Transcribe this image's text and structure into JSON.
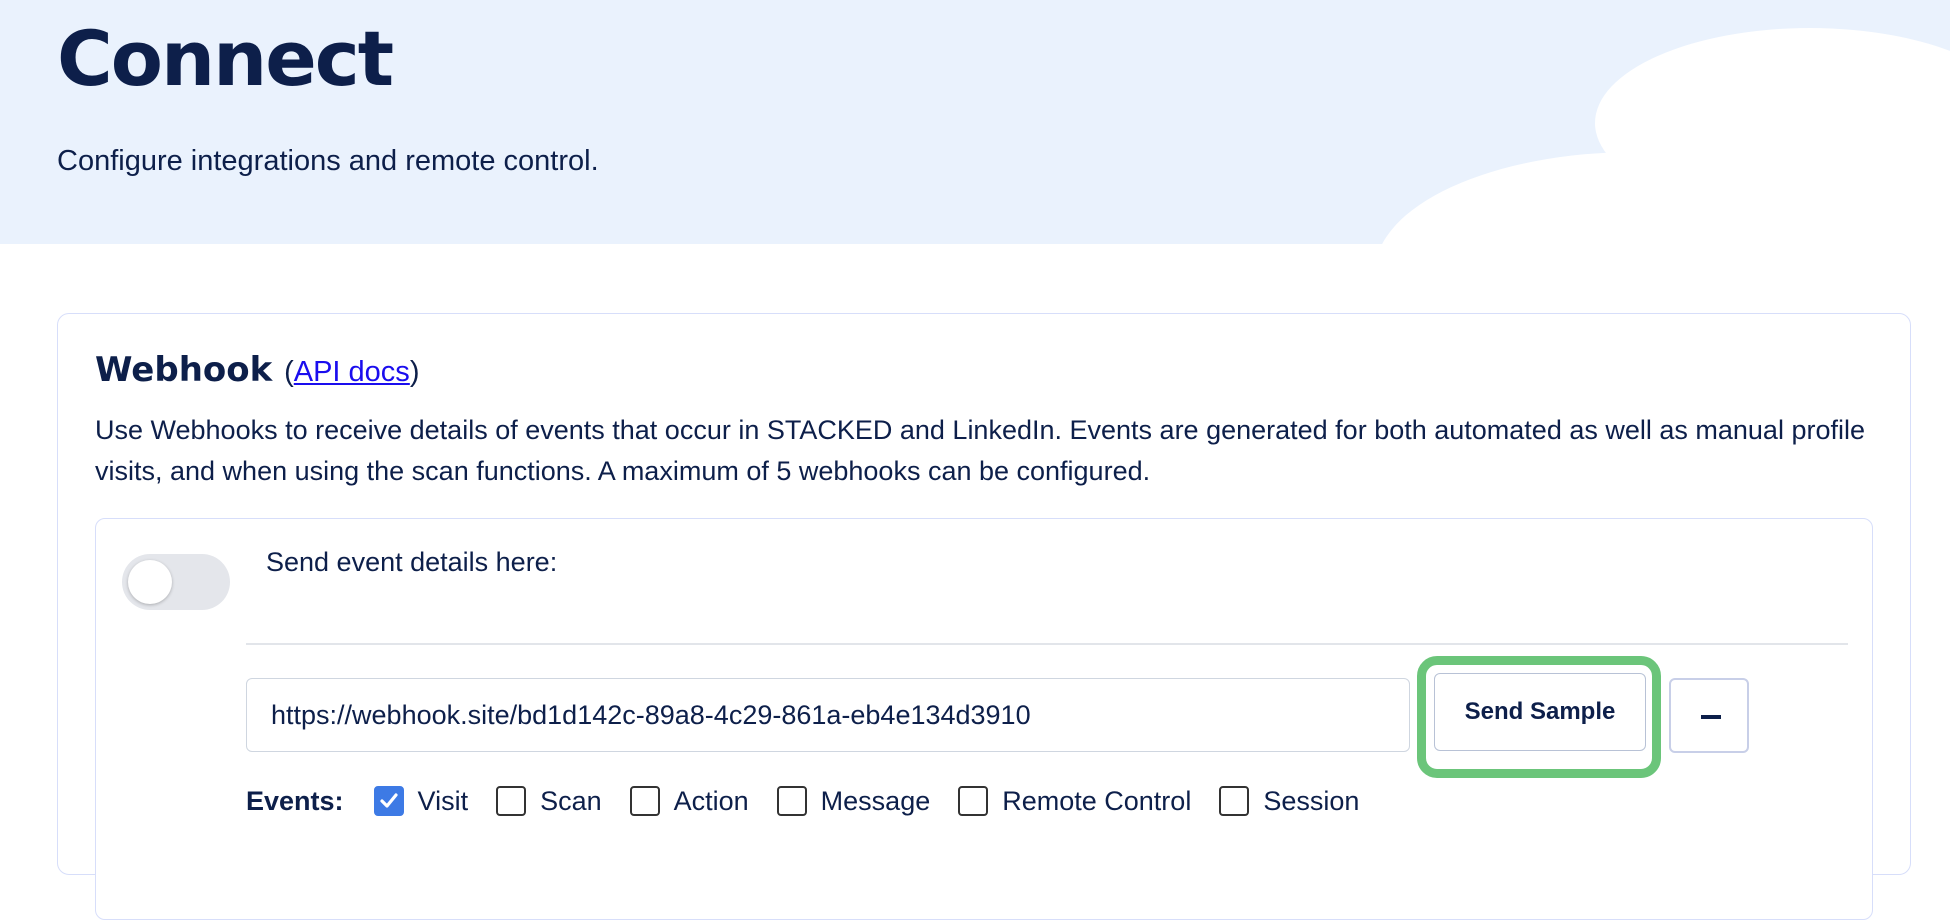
{
  "page": {
    "title": "Connect",
    "subtitle": "Configure integrations and remote control."
  },
  "webhook": {
    "title": "Webhook",
    "api_docs_open": "(",
    "api_docs_label": "API docs",
    "api_docs_close": ")",
    "description": "Use Webhooks to receive details of events that occur in STACKED and LinkedIn. Events are generated for both automated as well as manual profile visits, and when using the scan functions. A maximum of 5 webhooks can be configured.",
    "entry": {
      "enabled": false,
      "send_label": "Send event details here:",
      "url_value": "https://webhook.site/bd1d142c-89a8-4c29-861a-eb4e134d3910",
      "send_sample_label": "Send Sample",
      "events_label": "Events:",
      "events": [
        {
          "label": "Visit",
          "checked": true
        },
        {
          "label": "Scan",
          "checked": false
        },
        {
          "label": "Action",
          "checked": false
        },
        {
          "label": "Message",
          "checked": false
        },
        {
          "label": "Remote Control",
          "checked": false
        },
        {
          "label": "Session",
          "checked": false
        }
      ]
    }
  },
  "colors": {
    "hero_bg": "#eaf2fd",
    "text_primary": "#0d1f4a",
    "link": "#1a0dee",
    "checkbox_checked": "#3d7ae5",
    "highlight": "#6bc57a"
  }
}
